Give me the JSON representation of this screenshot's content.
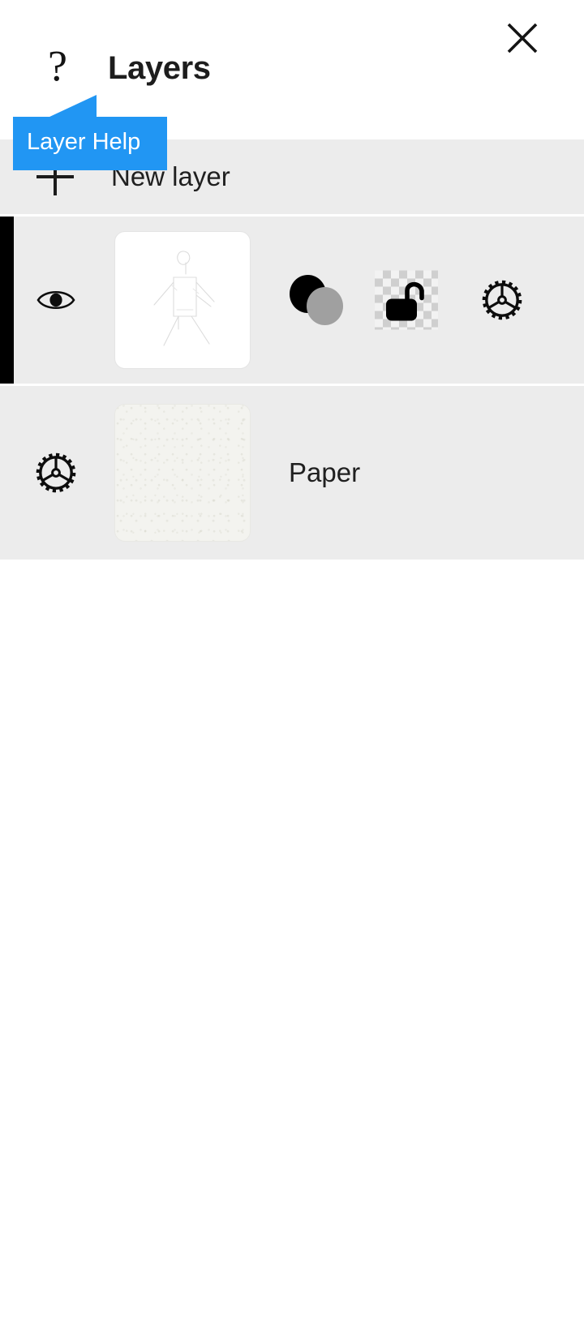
{
  "panel": {
    "title": "Layers",
    "help_icon": "question-mark",
    "close_icon": "close-x",
    "background": "#ffffff",
    "row_background": "#ececec"
  },
  "tooltip": {
    "text": "Layer Help",
    "background": "#2196f3",
    "text_color": "#ffffff"
  },
  "new_layer_row": {
    "icon": "plus-icon",
    "label": "New layer"
  },
  "layers": [
    {
      "name": "",
      "selected": true,
      "selection_color": "#000000",
      "visibility_icon": "eye-icon",
      "thumbnail": "sketch-figure-thumbnail",
      "blend_icon": "opacity-circles-icon",
      "lock_icon": "unlocked-padlock-icon",
      "lock_background": "transparency-checkerboard",
      "settings_icon": "gear-icon"
    },
    {
      "name": "Paper",
      "selected": false,
      "settings_icon": "gear-icon",
      "thumbnail": "paper-texture-thumbnail"
    }
  ]
}
